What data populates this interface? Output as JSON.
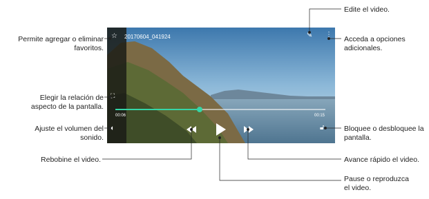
{
  "labels": {
    "favorites": [
      "Permite agregar o eliminar",
      "favoritos."
    ],
    "aspect": [
      "Elegir la relación de",
      "aspecto de la pantalla."
    ],
    "volume": [
      "Ajuste el volumen del",
      "sonido."
    ],
    "rewind": "Rebobine el video.",
    "edit": "Edite el video.",
    "options": [
      "Acceda a opciones",
      "adicionales."
    ],
    "lock": [
      "Bloquee o desbloquee la",
      "pantalla."
    ],
    "forward": "Avance rápido el video.",
    "play": [
      "Pause o reproduzca",
      "el video."
    ]
  },
  "player": {
    "filename": "20170604_041924",
    "time_elapsed": "00:06",
    "time_total": "00:15",
    "progress": 0.4
  },
  "icons": {
    "favorite": "star-icon",
    "aspect": "aspect-ratio-icon",
    "volume": "volume-icon",
    "edit": "pencil-icon",
    "options": "more-options-icon",
    "lock": "lock-icon",
    "rewind": "rewind-icon",
    "play": "play-icon",
    "forward": "fast-forward-icon"
  },
  "colors": {
    "accent": "#35d6a7"
  }
}
